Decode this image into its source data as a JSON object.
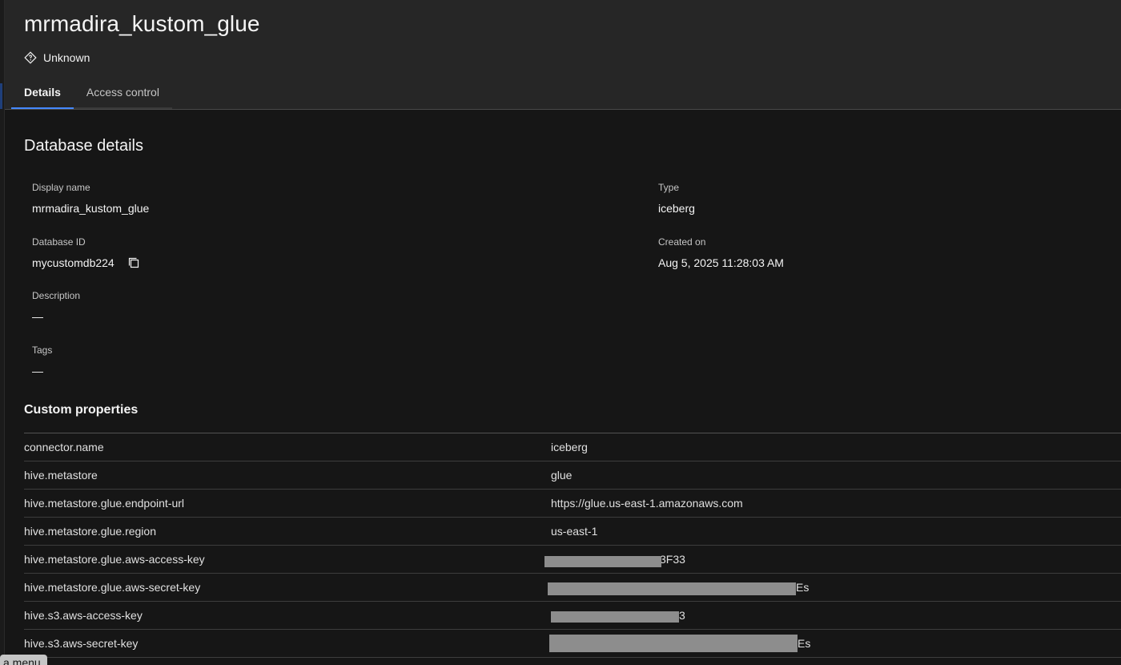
{
  "header": {
    "title": "mrmadira_kustom_glue",
    "status_label": "Unknown",
    "tabs": [
      {
        "label": "Details",
        "active": true
      },
      {
        "label": "Access control",
        "active": false
      }
    ]
  },
  "details": {
    "section_title": "Database details",
    "display_name_label": "Display name",
    "display_name_value": "mrmadira_kustom_glue",
    "type_label": "Type",
    "type_value": "iceberg",
    "database_id_label": "Database ID",
    "database_id_value": "mycustomdb224",
    "created_on_label": "Created on",
    "created_on_value": "Aug 5, 2025 11:28:03 AM",
    "description_label": "Description",
    "description_value": "—",
    "tags_label": "Tags",
    "tags_value": "—"
  },
  "custom_properties": {
    "title": "Custom properties",
    "rows": [
      {
        "key": "connector.name",
        "value": "iceberg"
      },
      {
        "key": "hive.metastore",
        "value": "glue"
      },
      {
        "key": "hive.metastore.glue.endpoint-url",
        "value": "https://glue.us-east-1.amazonaws.com"
      },
      {
        "key": "hive.metastore.glue.region",
        "value": "us-east-1"
      },
      {
        "key": "hive.metastore.glue.aws-access-key",
        "value": "3F33"
      },
      {
        "key": "hive.metastore.glue.aws-secret-key",
        "value": "Es"
      },
      {
        "key": "hive.s3.aws-access-key",
        "value": "3"
      },
      {
        "key": "hive.s3.aws-secret-key",
        "value": "Es"
      }
    ]
  },
  "overflow_menu_label": "a menu",
  "icons": {
    "status": "unknown-status-icon",
    "copy": "copy-icon"
  },
  "colors": {
    "background": "#161616",
    "header_bg": "#262626",
    "tab_active_underline": "#4589ff",
    "redaction": "#8d8d8d"
  }
}
